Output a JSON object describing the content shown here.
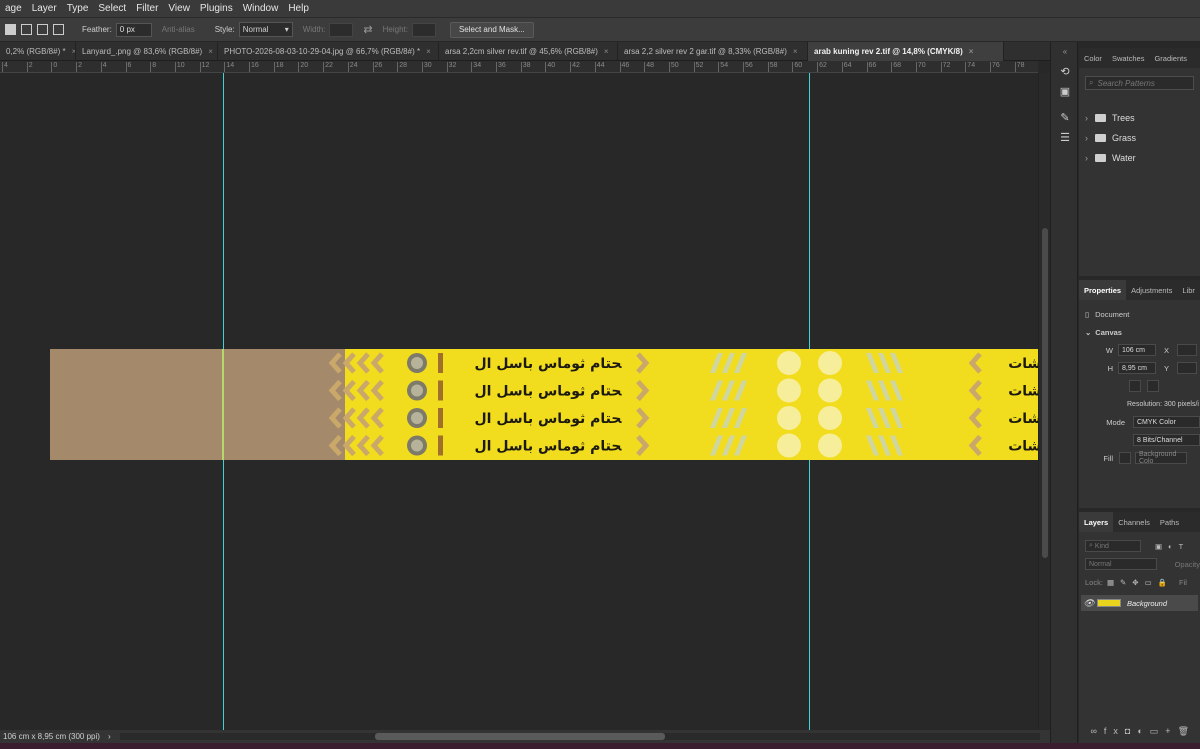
{
  "menu": [
    "age",
    "Layer",
    "Type",
    "Select",
    "Filter",
    "View",
    "Plugins",
    "Window",
    "Help"
  ],
  "options": {
    "feather_label": "Feather:",
    "feather_value": "0 px",
    "antialias_label": "Anti-alias",
    "style_label": "Style:",
    "style_value": "Normal",
    "width_label": "Width:",
    "height_label": "Height:",
    "select_mask_label": "Select and Mask..."
  },
  "tabs": [
    {
      "label": "0,2% (RGB/8#) *"
    },
    {
      "label": "Lanyard_.png @ 83,6% (RGB/8#)"
    },
    {
      "label": "PHOTO-2026-08-03-10-29-04.jpg @ 66,7% (RGB/8#) *"
    },
    {
      "label": "arsa 2,2cm silver rev.tif @ 45,6% (RGB/8#)"
    },
    {
      "label": "arsa 2,2 silver rev 2 gar.tif @ 8,33% (RGB/8#)"
    },
    {
      "label": "arab kuning rev 2.tif @ 14,8% (CMYK/8)",
      "active": true
    }
  ],
  "ruler_labels": [
    "4",
    "2",
    "0",
    "2",
    "4",
    "6",
    "8",
    "10",
    "12",
    "14",
    "16",
    "18",
    "20",
    "22",
    "24",
    "26",
    "28",
    "30",
    "32",
    "34",
    "36",
    "38",
    "40",
    "42",
    "44",
    "46",
    "48",
    "50",
    "52",
    "54",
    "56",
    "58",
    "60",
    "62",
    "64",
    "66",
    "68",
    "70",
    "72",
    "74",
    "76",
    "78"
  ],
  "doc_text": {
    "main_line": "ﺤﺘﺎم ﺛﻮﻣﺎس ﺑﺎﺳﻞ ﺍﻝ",
    "right_text": "ﺸﺎت"
  },
  "colors": {
    "strip_yellow": "#f2dc1e",
    "strip_tan": "#a4896a",
    "guide": "#3fd3d7"
  },
  "status": {
    "doc_info": "106 cm x 8,95 cm (300 ppi)",
    "arrow": "›"
  },
  "right_panel": {
    "top_tabs": [
      "Color",
      "Swatches",
      "Gradients"
    ],
    "search_placeholder": "Search Patterns",
    "folders": [
      "Trees",
      "Grass",
      "Water"
    ],
    "props_tabs": [
      "Properties",
      "Adjustments",
      "Libr"
    ],
    "doc_label": "Document",
    "canvas_label": "Canvas",
    "w_label": "W",
    "w_value": "106 cm",
    "h_label": "H",
    "h_value": "8,95 cm",
    "x_label": "X",
    "y_label": "Y",
    "resolution": "Resolution: 300 pixels/i",
    "mode_label": "Mode",
    "mode_value": "CMYK Color",
    "bits_value": "8 Bits/Channel",
    "fill_label": "Fill",
    "fill_value": "Background Colo",
    "layers_tabs": [
      "Layers",
      "Channels",
      "Paths"
    ],
    "kind_placeholder": "Kind",
    "blend_value": "Normal",
    "opacity_label": "Opacity",
    "lock_label": "Lock:",
    "fill_short": "Fil",
    "layer_name": "Background"
  }
}
